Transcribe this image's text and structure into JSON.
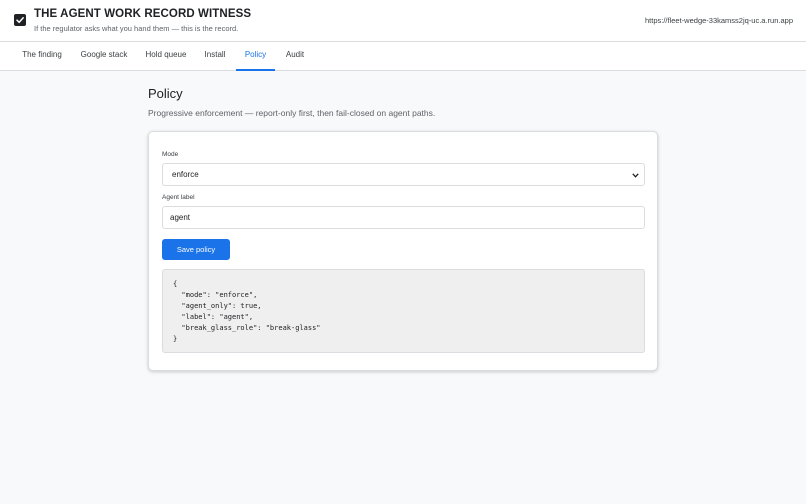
{
  "app": {
    "title": "THE AGENT WORK RECORD WITNESS",
    "subtitle": "If the regulator asks what you hand them — this is the record.",
    "url": "https://fleet-wedge-33kamss2jq-uc.a.run.app",
    "logo_icon": "checkbox-check-icon"
  },
  "tabs": [
    {
      "label": "The finding"
    },
    {
      "label": "Google stack"
    },
    {
      "label": "Hold queue"
    },
    {
      "label": "Install"
    },
    {
      "label": "Policy",
      "active": true
    },
    {
      "label": "Audit"
    }
  ],
  "page": {
    "title": "Policy",
    "description": "Progressive enforcement — report-only first, then fail-closed on agent paths."
  },
  "form": {
    "mode_label": "Mode",
    "mode_value": "enforce",
    "agent_label_label": "Agent label",
    "agent_label_value": "agent",
    "save_label": "Save policy",
    "policy_json": "{\n  \"mode\": \"enforce\",\n  \"agent_only\": true,\n  \"label\": \"agent\",\n  \"break_glass_role\": \"break-glass\"\n}"
  },
  "colors": {
    "accent": "#1a73e8",
    "background": "#f8f9fa",
    "text": "#202124"
  }
}
